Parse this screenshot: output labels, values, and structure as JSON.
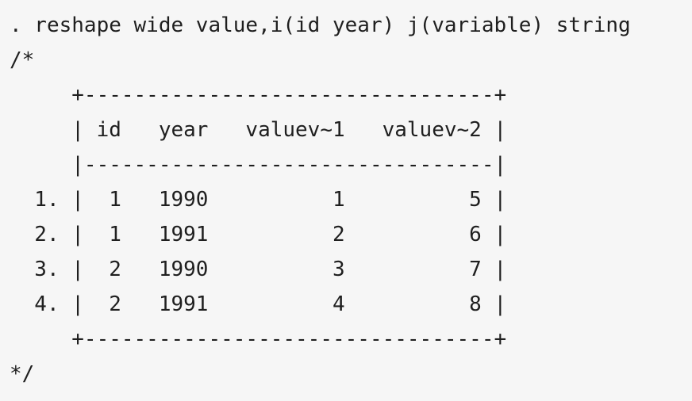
{
  "code": {
    "command": ". reshape wide value,i(id year) j(variable) string",
    "comment_open": "/*",
    "comment_close": "*/",
    "output": {
      "border_top": "     +---------------------------------+",
      "header": "     | id   year   valuev~1   valuev~2 |",
      "separator": "     |---------------------------------|",
      "rows": [
        "  1. |  1   1990          1          5 |",
        "  2. |  1   1991          2          6 |",
        "  3. |  2   1990          3          7 |",
        "  4. |  2   1991          4          8 |"
      ],
      "border_bottom": "     +---------------------------------+"
    }
  }
}
